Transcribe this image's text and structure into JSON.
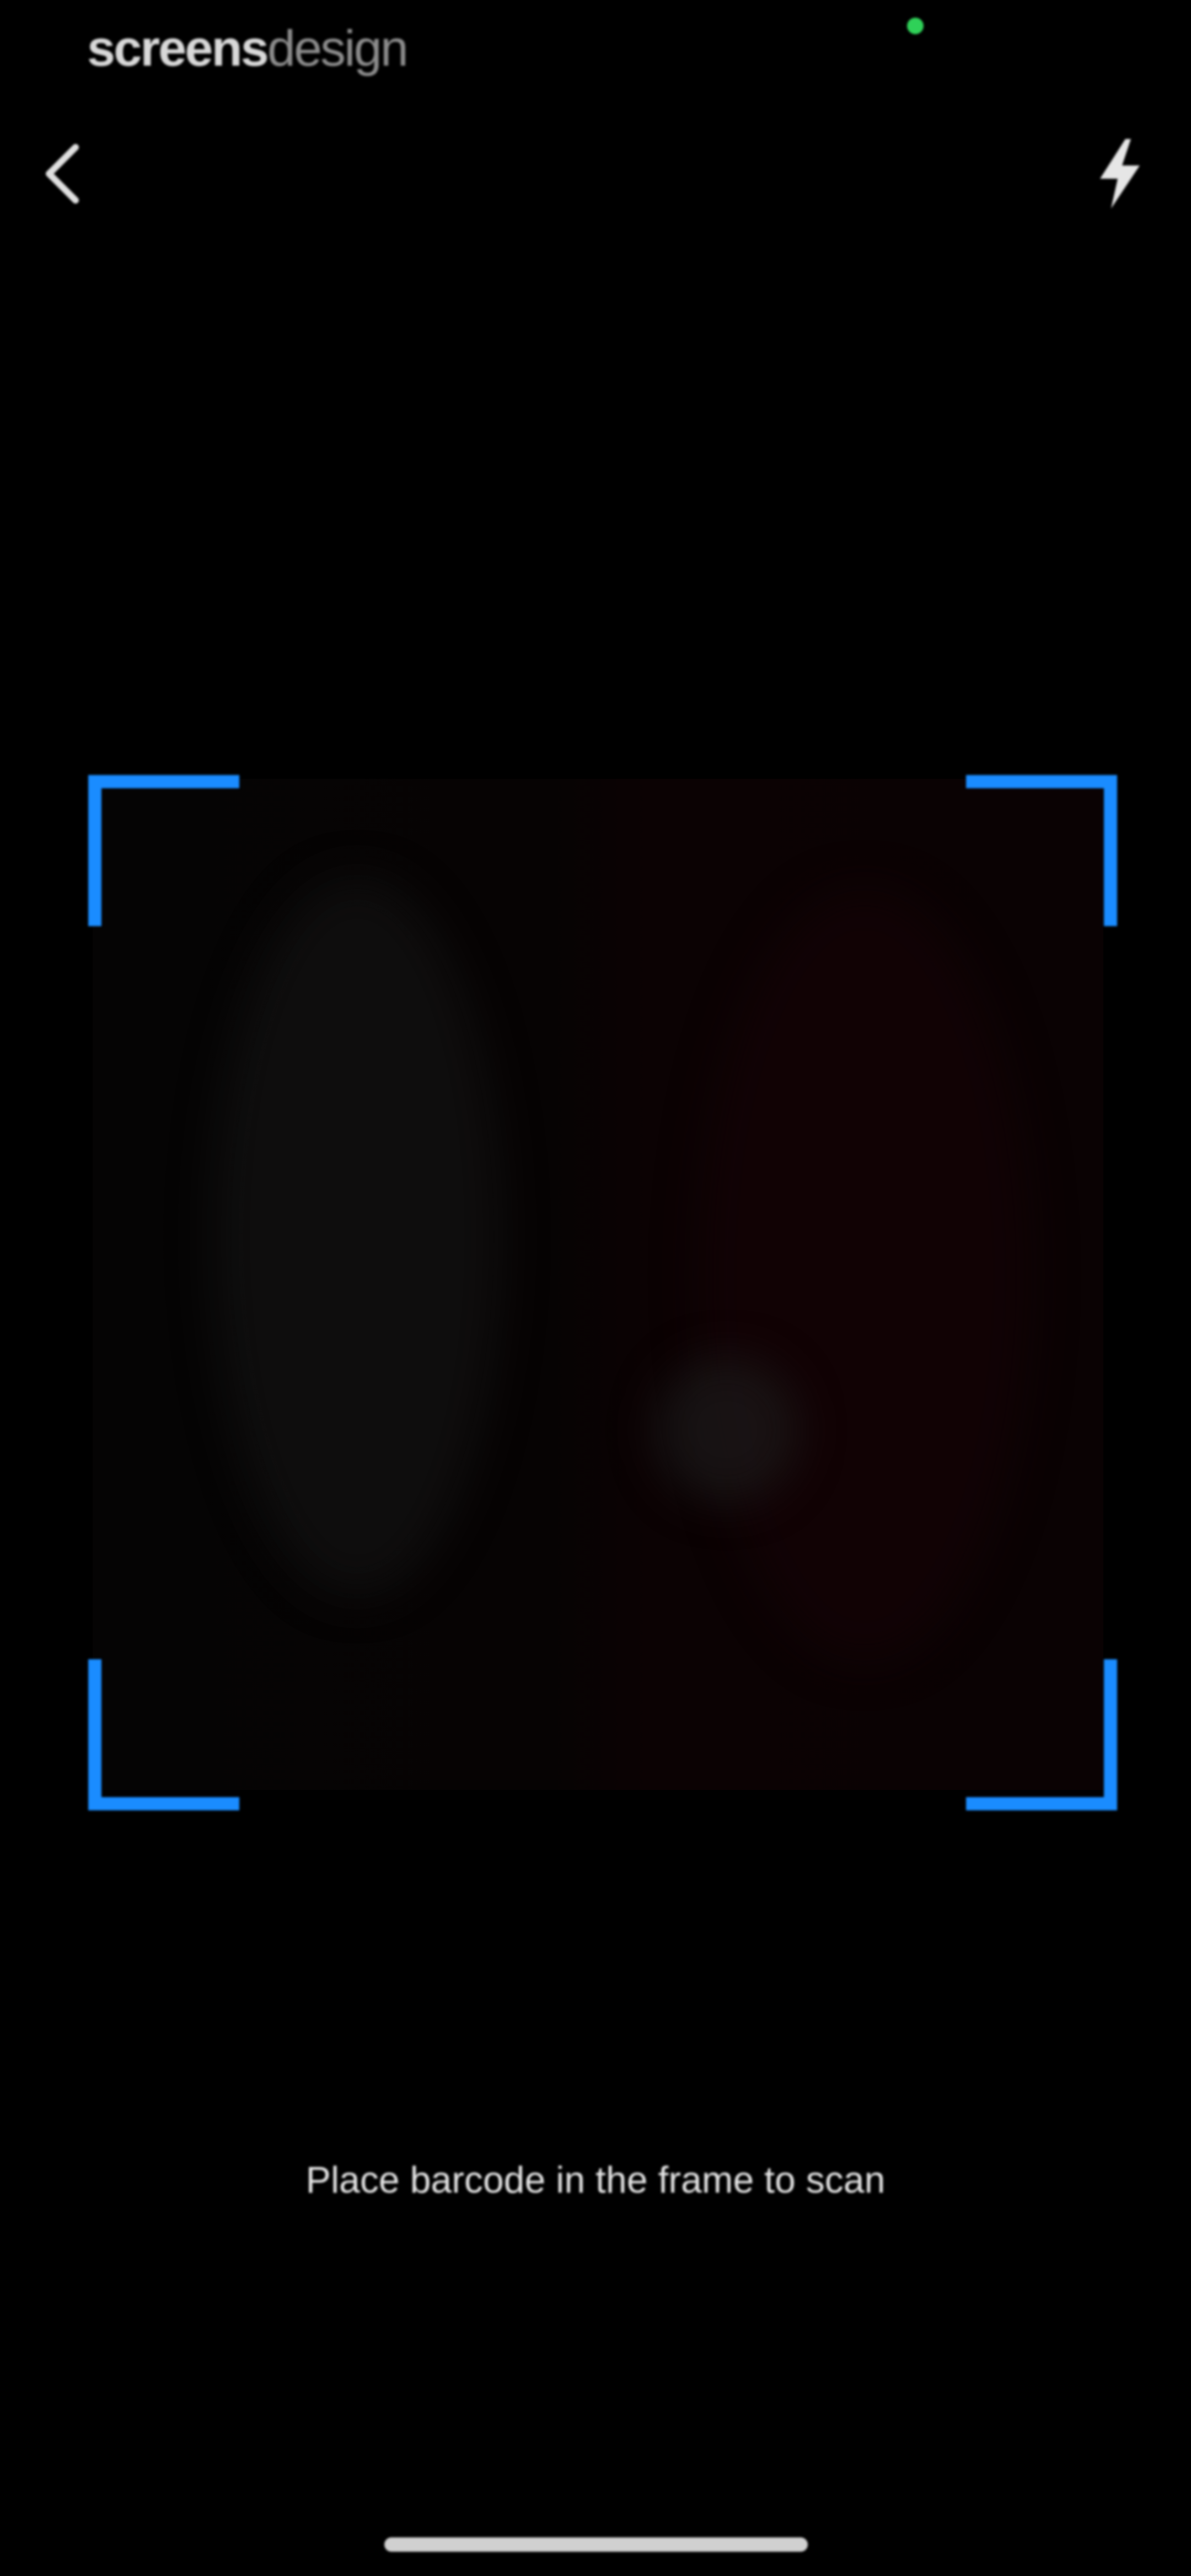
{
  "status_bar": {
    "watermark_strong": "screens",
    "watermark_light": "design",
    "indicator_color": "#2fd158"
  },
  "nav": {
    "back_icon": "chevron-left-icon",
    "flash_icon": "lightning-bolt-icon"
  },
  "scanner": {
    "frame_color": "#1a8cff",
    "instruction": "Place barcode in the frame to scan"
  }
}
